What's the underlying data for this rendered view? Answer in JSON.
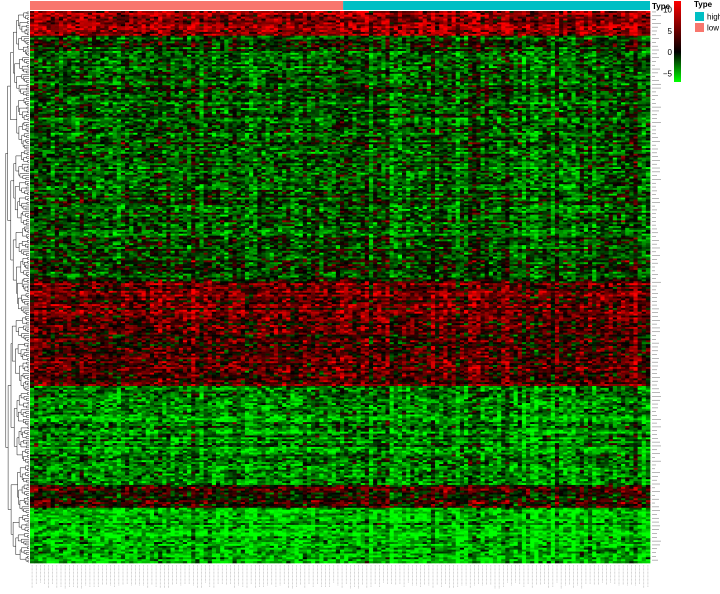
{
  "chart_data": {
    "type": "heatmap",
    "title": "",
    "xlabel": "",
    "ylabel": "",
    "annotation": {
      "title": "Type",
      "groups": [
        {
          "name": "low",
          "color": "#F8766D",
          "fraction": 0.505
        },
        {
          "name": "high",
          "color": "#00BFC4",
          "fraction": 0.495
        }
      ]
    },
    "legend": {
      "title": "Type",
      "entries": [
        {
          "label": "high",
          "color": "#00BFC4"
        },
        {
          "label": "low",
          "color": "#F8766D"
        }
      ],
      "placement": "top-right"
    },
    "colorbar": {
      "ticks": [
        "10",
        "5",
        "0",
        "−5"
      ],
      "tick_values": [
        10,
        5,
        0,
        -5
      ],
      "range": [
        -7,
        12
      ],
      "colors": [
        "#00FF00",
        "#000000",
        "#FF0000"
      ],
      "placement": "top-right"
    },
    "matrix": {
      "rows": 290,
      "cols": 150,
      "row_blocks": [
        {
          "to_fraction": 0.005,
          "mean": 0.6
        },
        {
          "to_fraction": 0.045,
          "mean": 0.55
        },
        {
          "to_fraction": 0.075,
          "mean": -0.25
        },
        {
          "to_fraction": 0.43,
          "mean": -0.3
        },
        {
          "to_fraction": 0.49,
          "mean": -0.15
        },
        {
          "to_fraction": 0.56,
          "mean": 0.4
        },
        {
          "to_fraction": 0.68,
          "mean": 0.3
        },
        {
          "to_fraction": 0.86,
          "mean": -0.5
        },
        {
          "to_fraction": 0.9,
          "mean": 0.15
        },
        {
          "to_fraction": 1.0,
          "mean": -0.7
        }
      ]
    },
    "row_dendrogram": true,
    "col_labels_shown": true,
    "row_labels_shown": true
  }
}
